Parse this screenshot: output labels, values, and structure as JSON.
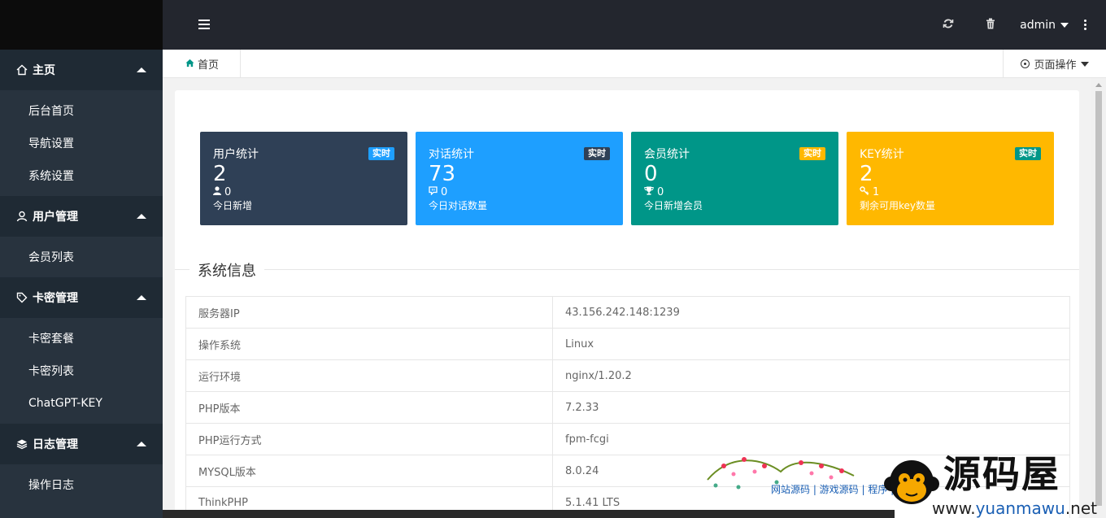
{
  "sidebar": {
    "groups": [
      {
        "label": "主页",
        "icon": "home-icon",
        "items": [
          "后台首页",
          "导航设置",
          "系统设置"
        ]
      },
      {
        "label": "用户管理",
        "icon": "user-icon",
        "items": [
          "会员列表"
        ]
      },
      {
        "label": "卡密管理",
        "icon": "tag-icon",
        "items": [
          "卡密套餐",
          "卡密列表",
          "ChatGPT-KEY"
        ]
      },
      {
        "label": "日志管理",
        "icon": "layers-icon",
        "items": [
          "操作日志"
        ]
      }
    ]
  },
  "header": {
    "user": "admin"
  },
  "tabbar": {
    "home_tab": "首页",
    "page_ops": "页面操作"
  },
  "cards": [
    {
      "title": "用户统计",
      "badge": "实时",
      "value": "2",
      "sub_value": "0",
      "desc": "今日新增",
      "bg": "#2f4056",
      "badge_bg": "#1e9fff",
      "badge_color": "#fff",
      "icon": "user-icon"
    },
    {
      "title": "对话统计",
      "badge": "实时",
      "value": "73",
      "sub_value": "0",
      "desc": "今日对话数量",
      "bg": "#1e9fff",
      "badge_bg": "#2f4056",
      "badge_color": "#fff",
      "icon": "chat-icon"
    },
    {
      "title": "会员统计",
      "badge": "实时",
      "value": "0",
      "sub_value": "0",
      "desc": "今日新增会员",
      "bg": "#009688",
      "badge_bg": "#ffb800",
      "badge_color": "#fff",
      "icon": "trophy-icon"
    },
    {
      "title": "KEY统计",
      "badge": "实时",
      "value": "2",
      "sub_value": "1",
      "desc": "剩余可用key数量",
      "bg": "#ffb800",
      "badge_bg": "#009688",
      "badge_color": "#fff",
      "icon": "key-icon"
    }
  ],
  "system_info": {
    "title": "系统信息",
    "rows": [
      [
        "服务器IP",
        "43.156.242.148:1239"
      ],
      [
        "操作系统",
        "Linux"
      ],
      [
        "运行环境",
        "nginx/1.20.2"
      ],
      [
        "PHP版本",
        "7.2.33"
      ],
      [
        "PHP运行方式",
        "fpm-fcgi"
      ],
      [
        "MYSQL版本",
        "8.0.24"
      ],
      [
        "ThinkPHP",
        "5.1.41 LTS"
      ]
    ]
  },
  "watermark": {
    "brand": "源码屋",
    "url_prefix": "www.",
    "url_main": "yuanmawu",
    "url_suffix": ".net",
    "links": "网站源码 | 游戏源码 | 程序 | 模板"
  }
}
